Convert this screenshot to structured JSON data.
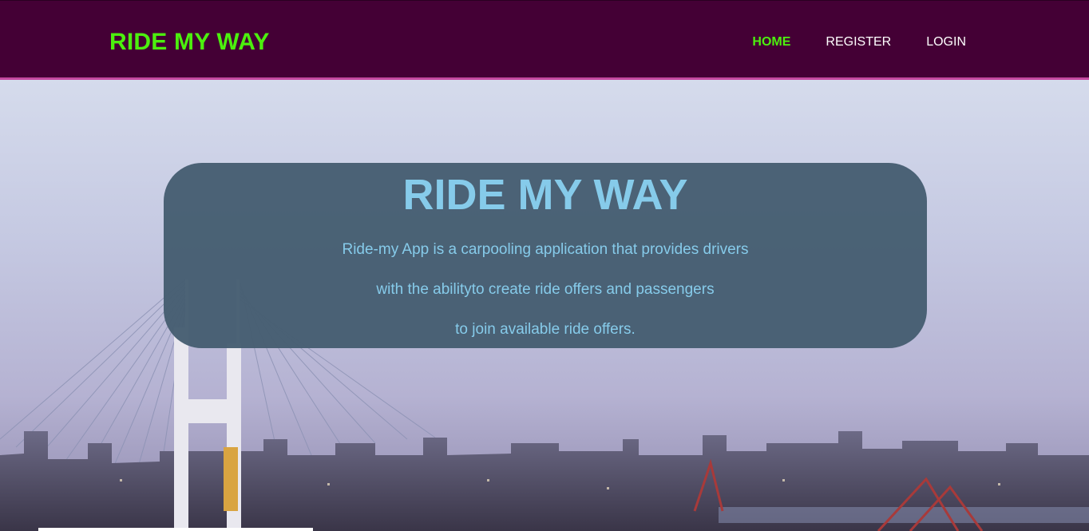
{
  "header": {
    "brand": "RIDE MY WAY",
    "nav": [
      {
        "label": "HOME",
        "active": true
      },
      {
        "label": "REGISTER",
        "active": false
      },
      {
        "label": "LOGIN",
        "active": false
      }
    ]
  },
  "hero": {
    "title": "RIDE MY WAY",
    "lines": [
      "Ride-my App is a carpooling application that provides drivers",
      "with the abilityto create ride offers and passengers",
      "to join available ride offers."
    ]
  },
  "colors": {
    "header_bg": "#440035",
    "brand_green": "#4cf00e",
    "card_bg": "#465e72",
    "card_text": "#86cbea"
  }
}
